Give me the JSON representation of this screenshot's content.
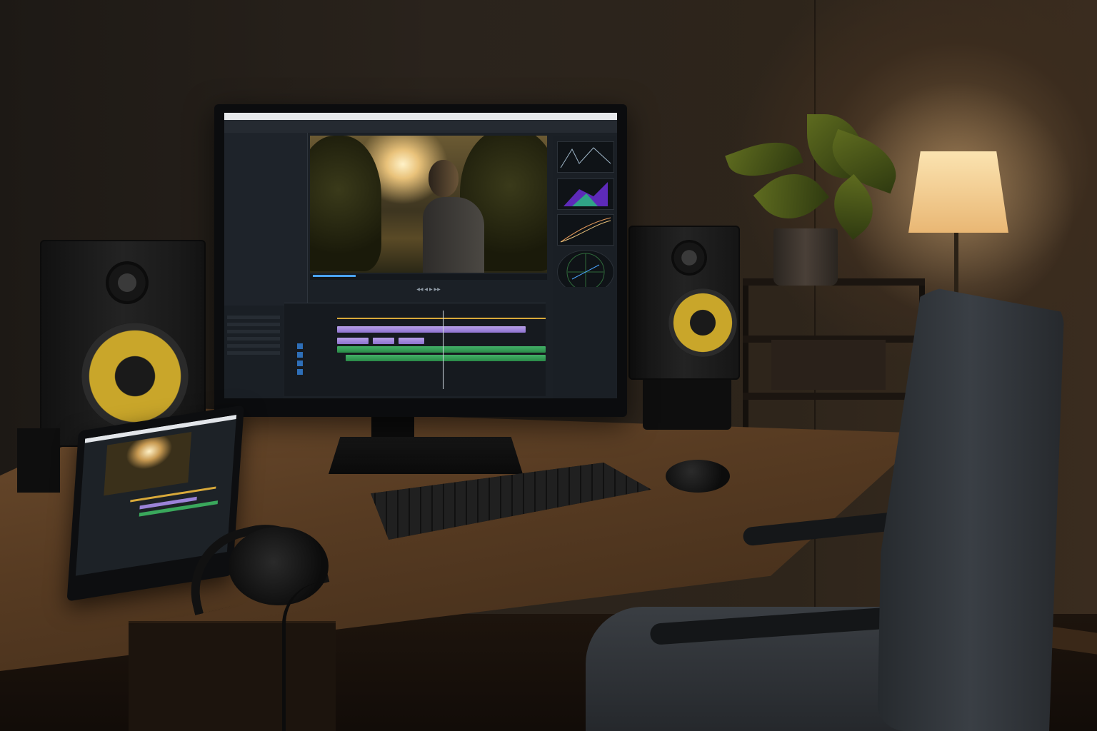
{
  "editor": {
    "toolbar": [
      "",
      "",
      ""
    ],
    "left_panel_label": "",
    "timeline_labels": [
      "",
      "",
      "",
      "",
      ""
    ],
    "timecode_lines": [
      "",
      ""
    ],
    "scope_labels": [
      "",
      "",
      "",
      ""
    ],
    "project_header": "",
    "right_panel_rows": [
      "",
      "",
      "",
      "",
      "",
      "",
      "",
      ""
    ]
  },
  "colors": {
    "accent": "#4aa3ff",
    "clip_video": "#9b83d8",
    "clip_audio": "#3aa85c",
    "ruler_marker": "#d8a93a",
    "speaker_cone": "#c9a62a",
    "lamp_shade": "#f3d29a"
  }
}
